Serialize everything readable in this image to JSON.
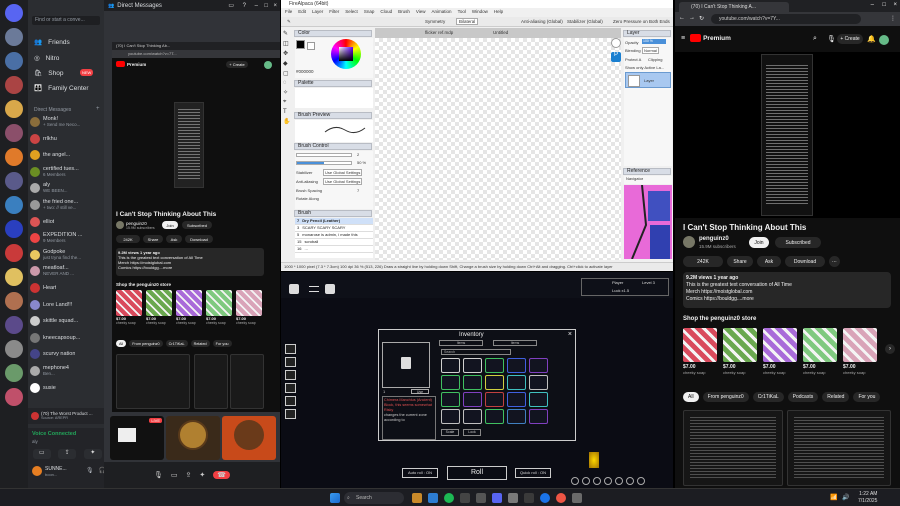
{
  "discord": {
    "title": "Direct Messages",
    "search_placeholder": "Find or start a conve...",
    "nav": [
      "Friends",
      "Nitro",
      "Shop",
      "Family Center"
    ],
    "shop_badge": "NEW",
    "dm_header": "Direct Messages",
    "dms": [
      {
        "name": "Monk!",
        "sub": "+ Send me Neco...",
        "color": "#8a6d3b"
      },
      {
        "name": "rrlkhu",
        "sub": "",
        "color": "#c44"
      },
      {
        "name": "the angel...",
        "sub": "",
        "color": "#e0a020"
      },
      {
        "name": "certified tues...",
        "sub": "6 Members",
        "color": "#6b8e23"
      },
      {
        "name": "aly",
        "sub": "WE BEEN...",
        "color": "#aaa"
      },
      {
        "name": "the fried one...",
        "sub": "+ two: // still ve...",
        "color": "#999"
      },
      {
        "name": "elliot",
        "sub": "",
        "color": "#d55"
      },
      {
        "name": "EXPEDITION ...",
        "sub": "9 Members",
        "color": "#e44"
      },
      {
        "name": "Godpoke",
        "sub": "just tryna find the...",
        "color": "#e8c860"
      },
      {
        "name": "meatloaf...",
        "sub": "NEVER AND ...",
        "color": "#c9a"
      },
      {
        "name": "Heart",
        "sub": "",
        "color": "#c33"
      },
      {
        "name": "Lore Land!!!",
        "sub": "",
        "color": "#88c"
      },
      {
        "name": "skittle squad...",
        "sub": "",
        "color": "#ccc"
      },
      {
        "name": "kneecapsoup...",
        "sub": "",
        "color": "#777"
      },
      {
        "name": "scurvy nation",
        "sub": "",
        "color": "#448"
      },
      {
        "name": "mephone4",
        "sub": "Ben...",
        "color": "#aaa"
      },
      {
        "name": "susie",
        "sub": "",
        "color": "#fff"
      }
    ],
    "server_tag_1": "VOID",
    "server_tag_2": "YURI",
    "activity": "(70) The Worst Product ...",
    "activity_sub": "Source: AREPR",
    "voice_status": "Voice Connected",
    "voice_channel": "aly",
    "user_name": "SUNNE...",
    "user_status": "boon..."
  },
  "yt_small": {
    "tab": "(70) I Can't Stop Thinking Ab...",
    "url": "youtube.com/watch?v=7T...",
    "premium": "Premium",
    "create": "+ Create",
    "title": "I Can't Stop Thinking About This",
    "channel": "penguinz0",
    "subs": "15.9M subscribers",
    "join": "Join",
    "subscribed": "Subscribed",
    "likes": "242K",
    "share": "Share",
    "ask": "Ask",
    "download": "Download",
    "views": "9.2M views  1 year ago",
    "desc1": "This is the greatest text conversation of All Time",
    "merch": "Merch https://moistglobal.com",
    "comics": "Comics https://bouldgg....more",
    "store": "Shop the penguinz0 store",
    "price": "$7.00",
    "prod": "cheeky soap",
    "chips": [
      "All",
      "From penguinz0",
      "Cr1TiKaL",
      "Related",
      "For you"
    ],
    "live": "LIVE"
  },
  "yt_big": {
    "tab": "(70) I Can't Stop Thinking A...",
    "url": "youtube.com/watch?v=7Y...",
    "premium": "Premium",
    "create": "+ Create",
    "title": "I Can't Stop Thinking About This",
    "channel": "penguinz0",
    "subs": "15.9M subscribers",
    "join": "Join",
    "subscribed": "Subscribed",
    "likes": "242K",
    "share": "Share",
    "ask": "Ask",
    "download": "Download",
    "views": "9.2M views  1 year ago",
    "desc1": "This is the greatest text conversation of All Time",
    "merch": "Merch https://moistglobal.com",
    "comics": "Comics https://bouldgg....more",
    "store": "Shop the penguinz0 store",
    "products": [
      {
        "price": "$7.00",
        "name": "cheeky soap",
        "color": "#d94a5c"
      },
      {
        "price": "$7.00",
        "name": "cheeky soap",
        "color": "#6aa84f"
      },
      {
        "price": "$7.00",
        "name": "cheeky soap",
        "color": "#a96bd9"
      },
      {
        "price": "$7.00",
        "name": "cheeky soap",
        "color": "#7fc97f"
      },
      {
        "price": "$7.00",
        "name": "cheeky soap",
        "color": "#d9a4b8"
      }
    ],
    "chips": [
      "All",
      "From penguinz0",
      "Cr1TiKaL",
      "Podcasts",
      "Related",
      "For you"
    ]
  },
  "firealpaca": {
    "title": "FireAlpaca (64bit)",
    "menu": [
      "File",
      "Edit",
      "Layer",
      "Filter",
      "Select",
      "Snap",
      "Cloud",
      "Brush",
      "View",
      "Animation",
      "Tool",
      "Window",
      "Help"
    ],
    "symmetry": "Symmetry",
    "snap_mode": "Bilateral",
    "antialias": "Anti-aliasing (Global)",
    "stabilizer": "Stabilizer (Global)",
    "stabilizer_val": "0",
    "zero_pressure": "Zero Pressure on Both Ends",
    "tab_file": "flicker ref.mdp",
    "tab_untitled": "Untitled",
    "color_panel": "Color",
    "hex": "#000000",
    "palette_panel": "Palette",
    "brush_preview": "Brush Preview",
    "brush_control": "Brush Control",
    "size_val": "2",
    "opacity_val": "50 %",
    "stabilizer_label": "Stabilizer",
    "stab_opt": "Use Global Settings",
    "aa_label": "Anti-aliasing",
    "aa_opt": "Use Global Settings",
    "spacing_label": "Brush Spacing",
    "spacing_val": "7",
    "rotate_label": "Rotate Along",
    "brush_panel": "Brush",
    "brushes": [
      {
        "num": "7",
        "name": "Dry Pencil (Leather)"
      },
      {
        "num": "3",
        "name": "SCARY SCARY SCARY"
      },
      {
        "num": "5",
        "name": "monarose is admin, i made this"
      },
      {
        "num": "15",
        "name": "scroball"
      },
      {
        "num": "16",
        "name": "..."
      }
    ],
    "layer_panel": "Layer",
    "opacity_label": "Opacity",
    "opacity_pct": "100 %",
    "blending_label": "Blending",
    "blending_val": "Normal",
    "protect": "Protect A",
    "clipping": "Clipping",
    "show_active": "Show only Active La...",
    "layer_name": "Layer",
    "reference_panel": "Reference",
    "navigator_panel": "Navigator",
    "status": "1000 * 1000 pixel  (7.3 * 7.3cm)  100 dpi  36 %  (513, 226)  Draw a straight line by holding down Shift, Change a brush size by holding down Ctrl+Alt and dragging. Ctrl+click to activate layer"
  },
  "game": {
    "title": "Inventory",
    "tabs": [
      "Items",
      "Items"
    ],
    "search": "Search",
    "item_desc": "Chimera Manchlus (Ancient) Block, this seems somewhat Risky",
    "item_desc2": "changes the current zone according to",
    "item_count": "1",
    "item_buttons": [
      "Use",
      "Scale",
      "Lock"
    ],
    "roll": "Roll",
    "auto_roll": "Auto roll : ON",
    "quick_roll": "Quick roll : ON",
    "player_info": "Player",
    "player_level": "Level 3",
    "luck": "Luck x1.5"
  },
  "taskbar": {
    "search": "Search",
    "time": "1:22 AM",
    "date": "7/1/2025"
  }
}
